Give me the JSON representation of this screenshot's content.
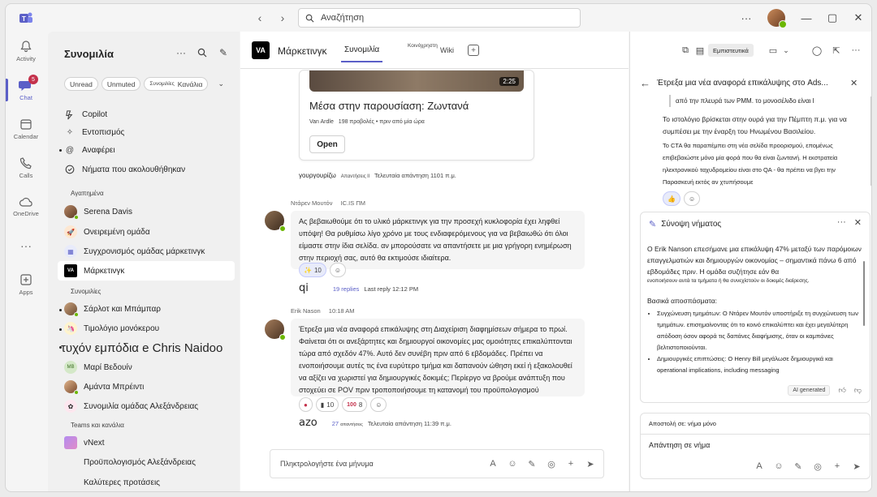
{
  "titlebar": {
    "search_placeholder": "Αναζήτηση"
  },
  "rail": [
    {
      "label": "Activity",
      "icon": "bell-icon"
    },
    {
      "label": "Chat",
      "icon": "chat-icon",
      "badge": "5"
    },
    {
      "label": "Calendar",
      "icon": "calendar-icon"
    },
    {
      "label": "Calls",
      "icon": "phone-icon"
    },
    {
      "label": "OneDrive",
      "icon": "cloud-icon"
    },
    {
      "label": "",
      "icon": "more-icon"
    },
    {
      "label": "Apps",
      "icon": "plus-box-icon"
    }
  ],
  "chatlist": {
    "title": "Συνομιλία",
    "filters": [
      "Unread",
      "Unmuted",
      "Συνομιλίες",
      "Κανάλια"
    ],
    "top_items": [
      "Copilot",
      "Εντοπισμός",
      "Αναφέρει",
      "Νήματα που ακολουθήθηκαν"
    ],
    "favorites_label": "Αγαπημένα",
    "favorites": [
      "Serena Davis",
      "Ονειρεμένη ομάδα",
      "Συγχρονισμός ομάδας μάρκετινγκ",
      "Μάρκετινγκ"
    ],
    "chats_label": "Συνομιλίες",
    "chats": [
      "Σάρλοτ και Μπάμπαρ",
      "Τιμολόγιο μονόκερου",
      "τυχόν εμπόδια e Chris Naidoo",
      "Μαρί Βεδουίν",
      "Αμάντα Μπρέιντι",
      "Συνομιλία ομάδας Αλεξάνδρειας"
    ],
    "teams_label": "Teams και κανάλια",
    "teams": [
      "vNext",
      "Προϋπολογισμός Αλεξάνδρειας",
      "Καλύτερες προτάσεις"
    ]
  },
  "main": {
    "title": "Μάρκετινγκ",
    "tabs": [
      "Συνομιλία",
      "Κοινόχρηστη",
      "Wiki"
    ],
    "card": {
      "duration": "2:25",
      "title": "Μέσα στην παρουσίαση: Ζωντανά",
      "author": "Van Ardle",
      "meta": "198 προβολές • πριν από μία ώρα",
      "button": "Open"
    },
    "reply1": {
      "big": "γουργουρίζω",
      "small": "Απαντήσεις ll",
      "last": "Τελευταία απάντηση 1101 π.μ."
    },
    "msg1": {
      "author": "Ντάρεν Μουτόν",
      "time": "IC.IS ΠΜ",
      "text": "Ας βεβαιωθούμε ότι το υλικό μάρκετινγκ για την προσεχή κυκλοφορία έχει ληφθεί υπόψη! Θα ρυθμίσω λίγο χρόνο με τους ενδιαφερόμενους για να βεβαιωθώ ότι όλοι είμαστε στην ίδια σελίδα. αν μπορούσατε να απαντήσετε με μια γρήγορη ενημέρωση στην περιοχή σας, αυτό θα εκτιμούσε ιδιαίτερα.",
      "reaction_count": "10",
      "reply_big": "qi",
      "replies": "19 replies",
      "last_reply": "Last reply 12:12 PM"
    },
    "msg2": {
      "author": "Erik Nason",
      "time": "10:18 AM",
      "text": "Έτρεξα μια νέα αναφορά επικάλυψης στη Διαχείριση διαφημίσεων σήμερα το πρωί. Φαίνεται ότι οι ανεξάρτητες και δημιουργοί οικονομίες μας ομοιότητες επικαλύπτονται τώρα από σχεδόν 47%. Αυτό δεν συνέβη πριν από 6 εβδομάδες. Πρέπει να ενοποιήσουμε αυτές τις ένα ευρύτερο τμήμα και δαπανούν ώθηση εκεί ή εξακολουθεί να αξίζει να χωριστεί για δημιουργικές δοκιμές; Περίεργο να βρούμε ανάπτυξη που στοχεύει σε POV πριν τροποποιήσουμε τη κατανομή του προϋπολογισμού",
      "reactions": [
        "10",
        "8"
      ],
      "reply_big": "azo",
      "replies": "27",
      "replies_small": "απαντήσεις",
      "last_reply": "Τελευταία απάντηση 11:39 π.μ."
    },
    "composer_placeholder": "Πληκτρολογήστε ένα μήνυμα"
  },
  "rpanel": {
    "sensitivity": "Εμπιστευτικά",
    "thread_title": "Έτρεξα μια νέα αναφορά επικάλυψης στο Ads...",
    "quote": "από την πλευρά των PMM. το μονοσέλιδο είναι l",
    "thread_p1": "Το ιστολόγιο βρίσκεται στην ουρά για την Πέμπτη π.μ. για να συμπέσει με την έναρξη του Ηνωμένου Βασιλείου.",
    "thread_p2": "Το CTA θα παραπέμπει στη νέα σελίδα προορισμού, επομένως επιβεβαιώστε μόνο μία φορά που θα είναι ζωντανή. Η εκστρατεία ηλεκτρονικού ταχυδρομείου είναι στο QA - θα πρέπει να βγει την Παρασκευή εκτός αν χτυπήσουμε",
    "summary": {
      "title": "Σύνοψη νήματος",
      "intro": "Ο Erik Nanson επεσήμανε μια επικάλυψη 47% μεταξύ των παρόμοιων επαγγελματιών και δημιουργών οικονομίας – σημαντικά πάνω 6 από εβδομάδες πριν. Η ομάδα συζήτησε εάν θα",
      "intro_small": "ενοποιήσουν αυτά τα τμήματα ή θα συνεχίστούν οι δοκιμές διαίρεσης.",
      "key_label": "Βασικά αποσπάσματα:",
      "bullet1": "Συγχώνευση τμημάτων: Ο Ντάρεν Μουτόν υποστήριξε τη συγχώνευση των τμημάτων. επισημαίνοντας ότι το κοινό επικαλύπτει και έχει μεγαλύτερη απόδοση όσον αφορά τις δαπάνες διαφήμισης, όταν οι καμπάνιες βελτιστοποιούνται.",
      "bullet2": "Δημιουργικές επιπτώσεις: Ο Henry Bill μεγάλωσε δημιουργικά και operational implications, including messaging",
      "ai_label": "AI generated"
    },
    "composer_to": "Αποστολή σε: νήμα μόνο",
    "composer_text": "Απάντηση σε νήμα"
  }
}
